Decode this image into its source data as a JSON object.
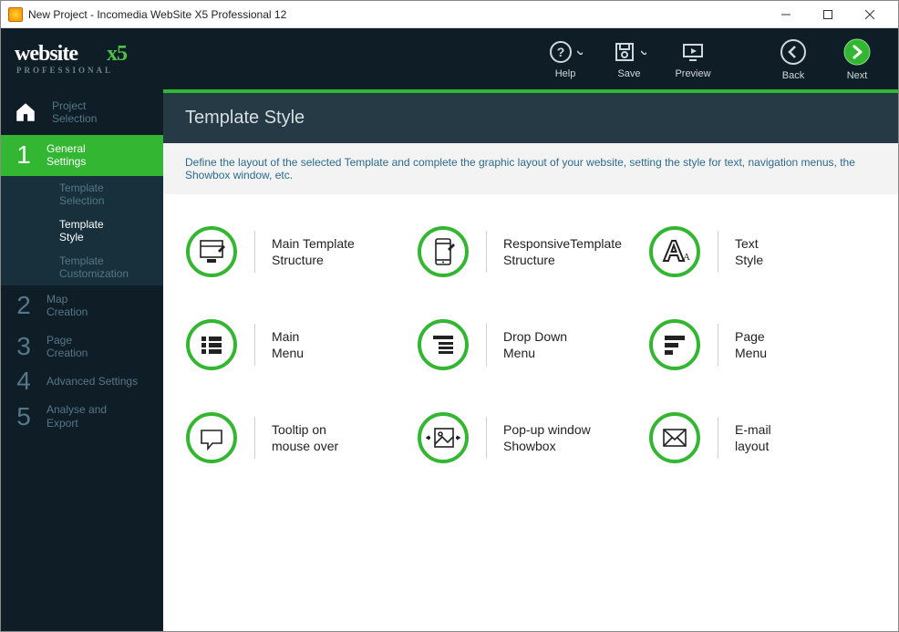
{
  "window": {
    "title": "New Project - Incomedia WebSite X5 Professional 12"
  },
  "logo": {
    "brand_a": "website",
    "brand_b": "x5",
    "sub": "PROFESSIONAL"
  },
  "toolbar": {
    "help": "Help",
    "save": "Save",
    "preview": "Preview",
    "back": "Back",
    "next": "Next"
  },
  "sidebar": {
    "home": "Project Selection",
    "steps": [
      {
        "num": "1",
        "label1": "General",
        "label2": "Settings",
        "subs": [
          {
            "label1": "Template",
            "label2": "Selection"
          },
          {
            "label1": "Template",
            "label2": "Style"
          },
          {
            "label1": "Template",
            "label2": "Customization"
          }
        ]
      },
      {
        "num": "2",
        "label1": "Map",
        "label2": "Creation"
      },
      {
        "num": "3",
        "label1": "Page",
        "label2": "Creation"
      },
      {
        "num": "4",
        "label1": "Advanced Settings",
        "label2": ""
      },
      {
        "num": "5",
        "label1": "Analyse and",
        "label2": "Export"
      }
    ]
  },
  "page": {
    "title": "Template Style",
    "description": "Define the layout of the selected Template and complete the graphic layout of your website, setting the style for text, navigation menus, the Showbox window, etc."
  },
  "cards": [
    [
      {
        "l1": "Main Template",
        "l2": "Structure"
      },
      {
        "l1": "ResponsiveTemplate",
        "l2": "Structure"
      },
      {
        "l1": "Text",
        "l2": "Style"
      }
    ],
    [
      {
        "l1": "Main",
        "l2": "Menu"
      },
      {
        "l1": "Drop Down",
        "l2": "Menu"
      },
      {
        "l1": "Page",
        "l2": "Menu"
      }
    ],
    [
      {
        "l1": "Tooltip on",
        "l2": "mouse over"
      },
      {
        "l1": "Pop-up window",
        "l2": "Showbox"
      },
      {
        "l1": "E-mail",
        "l2": "layout"
      }
    ]
  ]
}
